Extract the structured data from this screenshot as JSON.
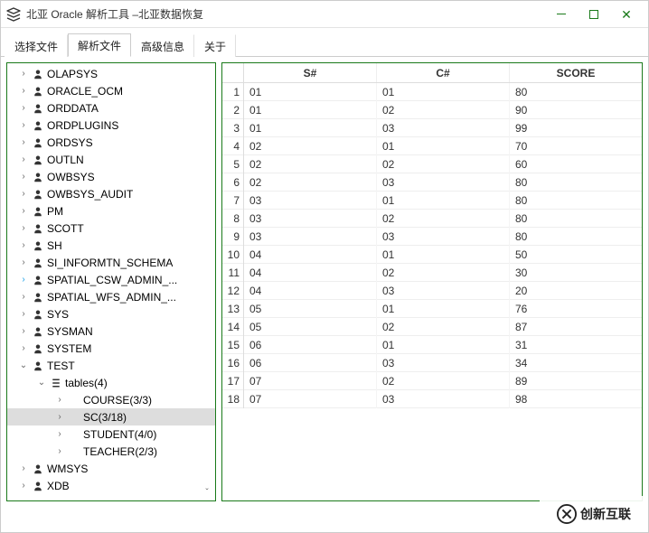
{
  "window": {
    "title": "北亚 Oracle 解析工具  –北亚数据恢复"
  },
  "tabs": [
    "选择文件",
    "解析文件",
    "高级信息",
    "关于"
  ],
  "active_tab_index": 1,
  "tree": [
    {
      "d": 1,
      "icon": "user",
      "exp": ">",
      "label": "OLAPSYS"
    },
    {
      "d": 1,
      "icon": "user",
      "exp": ">",
      "label": "ORACLE_OCM"
    },
    {
      "d": 1,
      "icon": "user",
      "exp": ">",
      "label": "ORDDATA"
    },
    {
      "d": 1,
      "icon": "user",
      "exp": ">",
      "label": "ORDPLUGINS"
    },
    {
      "d": 1,
      "icon": "user",
      "exp": ">",
      "label": "ORDSYS"
    },
    {
      "d": 1,
      "icon": "user",
      "exp": ">",
      "label": "OUTLN"
    },
    {
      "d": 1,
      "icon": "user",
      "exp": ">",
      "label": "OWBSYS"
    },
    {
      "d": 1,
      "icon": "user",
      "exp": ">",
      "label": "OWBSYS_AUDIT"
    },
    {
      "d": 1,
      "icon": "user",
      "exp": ">",
      "label": "PM"
    },
    {
      "d": 1,
      "icon": "user",
      "exp": ">",
      "label": "SCOTT"
    },
    {
      "d": 1,
      "icon": "user",
      "exp": ">",
      "label": "SH"
    },
    {
      "d": 1,
      "icon": "user",
      "exp": ">",
      "label": "SI_INFORMTN_SCHEMA"
    },
    {
      "d": 1,
      "icon": "user",
      "exp": ">",
      "label": "SPATIAL_CSW_ADMIN_...",
      "special": true
    },
    {
      "d": 1,
      "icon": "user",
      "exp": ">",
      "label": "SPATIAL_WFS_ADMIN_..."
    },
    {
      "d": 1,
      "icon": "user",
      "exp": ">",
      "label": "SYS"
    },
    {
      "d": 1,
      "icon": "user",
      "exp": ">",
      "label": "SYSMAN"
    },
    {
      "d": 1,
      "icon": "user",
      "exp": ">",
      "label": "SYSTEM"
    },
    {
      "d": 1,
      "icon": "user",
      "exp": "v",
      "label": "TEST"
    },
    {
      "d": 2,
      "icon": "list",
      "exp": "v",
      "label": "tables(4)"
    },
    {
      "d": 3,
      "icon": "none",
      "exp": ">",
      "label": "COURSE(3/3)"
    },
    {
      "d": 3,
      "icon": "none",
      "exp": ">",
      "label": "SC(3/18)",
      "selected": true
    },
    {
      "d": 3,
      "icon": "none",
      "exp": ">",
      "label": "STUDENT(4/0)"
    },
    {
      "d": 3,
      "icon": "none",
      "exp": ">",
      "label": "TEACHER(2/3)"
    },
    {
      "d": 1,
      "icon": "user",
      "exp": ">",
      "label": "WMSYS"
    },
    {
      "d": 1,
      "icon": "user",
      "exp": ">",
      "label": "XDB"
    }
  ],
  "table": {
    "columns": [
      "S#",
      "C#",
      "SCORE"
    ],
    "rows": [
      [
        "01",
        "01",
        "80"
      ],
      [
        "01",
        "02",
        "90"
      ],
      [
        "01",
        "03",
        "99"
      ],
      [
        "02",
        "01",
        "70"
      ],
      [
        "02",
        "02",
        "60"
      ],
      [
        "02",
        "03",
        "80"
      ],
      [
        "03",
        "01",
        "80"
      ],
      [
        "03",
        "02",
        "80"
      ],
      [
        "03",
        "03",
        "80"
      ],
      [
        "04",
        "01",
        "50"
      ],
      [
        "04",
        "02",
        "30"
      ],
      [
        "04",
        "03",
        "20"
      ],
      [
        "05",
        "01",
        "76"
      ],
      [
        "05",
        "02",
        "87"
      ],
      [
        "06",
        "01",
        "31"
      ],
      [
        "06",
        "03",
        "34"
      ],
      [
        "07",
        "02",
        "89"
      ],
      [
        "07",
        "03",
        "98"
      ]
    ]
  },
  "watermark": "创新互联"
}
